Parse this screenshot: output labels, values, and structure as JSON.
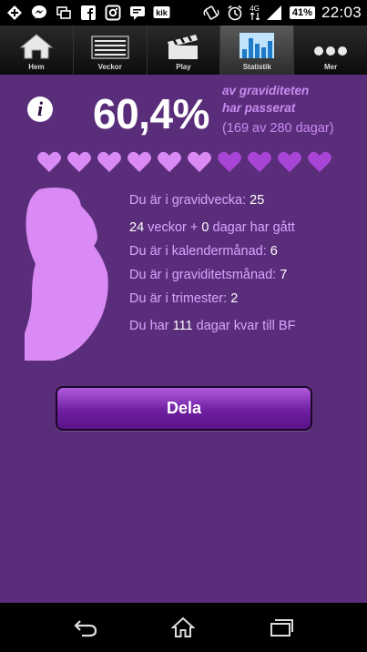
{
  "status_bar": {
    "time": "22:03",
    "battery": "41%",
    "network": "4G",
    "left_icons": [
      "add-icon",
      "messenger-icon",
      "screen-mirror-icon",
      "facebook-icon",
      "instagram-icon",
      "message-icon",
      "kik-icon"
    ],
    "right_icons": [
      "vibrate-icon",
      "alarm-icon",
      "signal-icon",
      "battery-icon"
    ]
  },
  "tabs": [
    {
      "label": "Hem",
      "icon": "home-icon",
      "active": false
    },
    {
      "label": "Veckor",
      "icon": "list-icon",
      "active": false
    },
    {
      "label": "Play",
      "icon": "clapperboard-icon",
      "active": false
    },
    {
      "label": "Statistik",
      "icon": "bar-chart-icon",
      "active": true
    },
    {
      "label": "Mer",
      "icon": "more-icon",
      "active": false
    }
  ],
  "progress": {
    "percent": "60,4%",
    "line1": "av graviditeten",
    "line2": "har passerat",
    "days": "(169 av 280 dagar)",
    "hearts_total": 10,
    "hearts_filled": 6,
    "heart_color_filled": "#d98af5",
    "heart_color_empty": "#a845d6"
  },
  "facts": {
    "week_label": "Du är i gravidvecka: ",
    "week_value": "25",
    "weeks_value": "24",
    "weeks_label": " veckor + ",
    "days_value": "0",
    "days_label": " dagar har gått",
    "calmonth_label": "Du är i kalendermånad: ",
    "calmonth_value": "6",
    "pregmonth_label": "Du är i graviditetsmånad: ",
    "pregmonth_value": "7",
    "trimester_label": "Du är i trimester: ",
    "trimester_value": "2",
    "left_prefix": "Du har ",
    "left_value": "111",
    "left_suffix": " dagar kvar till BF"
  },
  "share_button": "Dela",
  "nav": [
    "back-icon",
    "home-icon",
    "recent-apps-icon"
  ],
  "colors": {
    "background": "#5a2d7a",
    "accent": "#c88bf0",
    "belly": "#d98af5"
  }
}
